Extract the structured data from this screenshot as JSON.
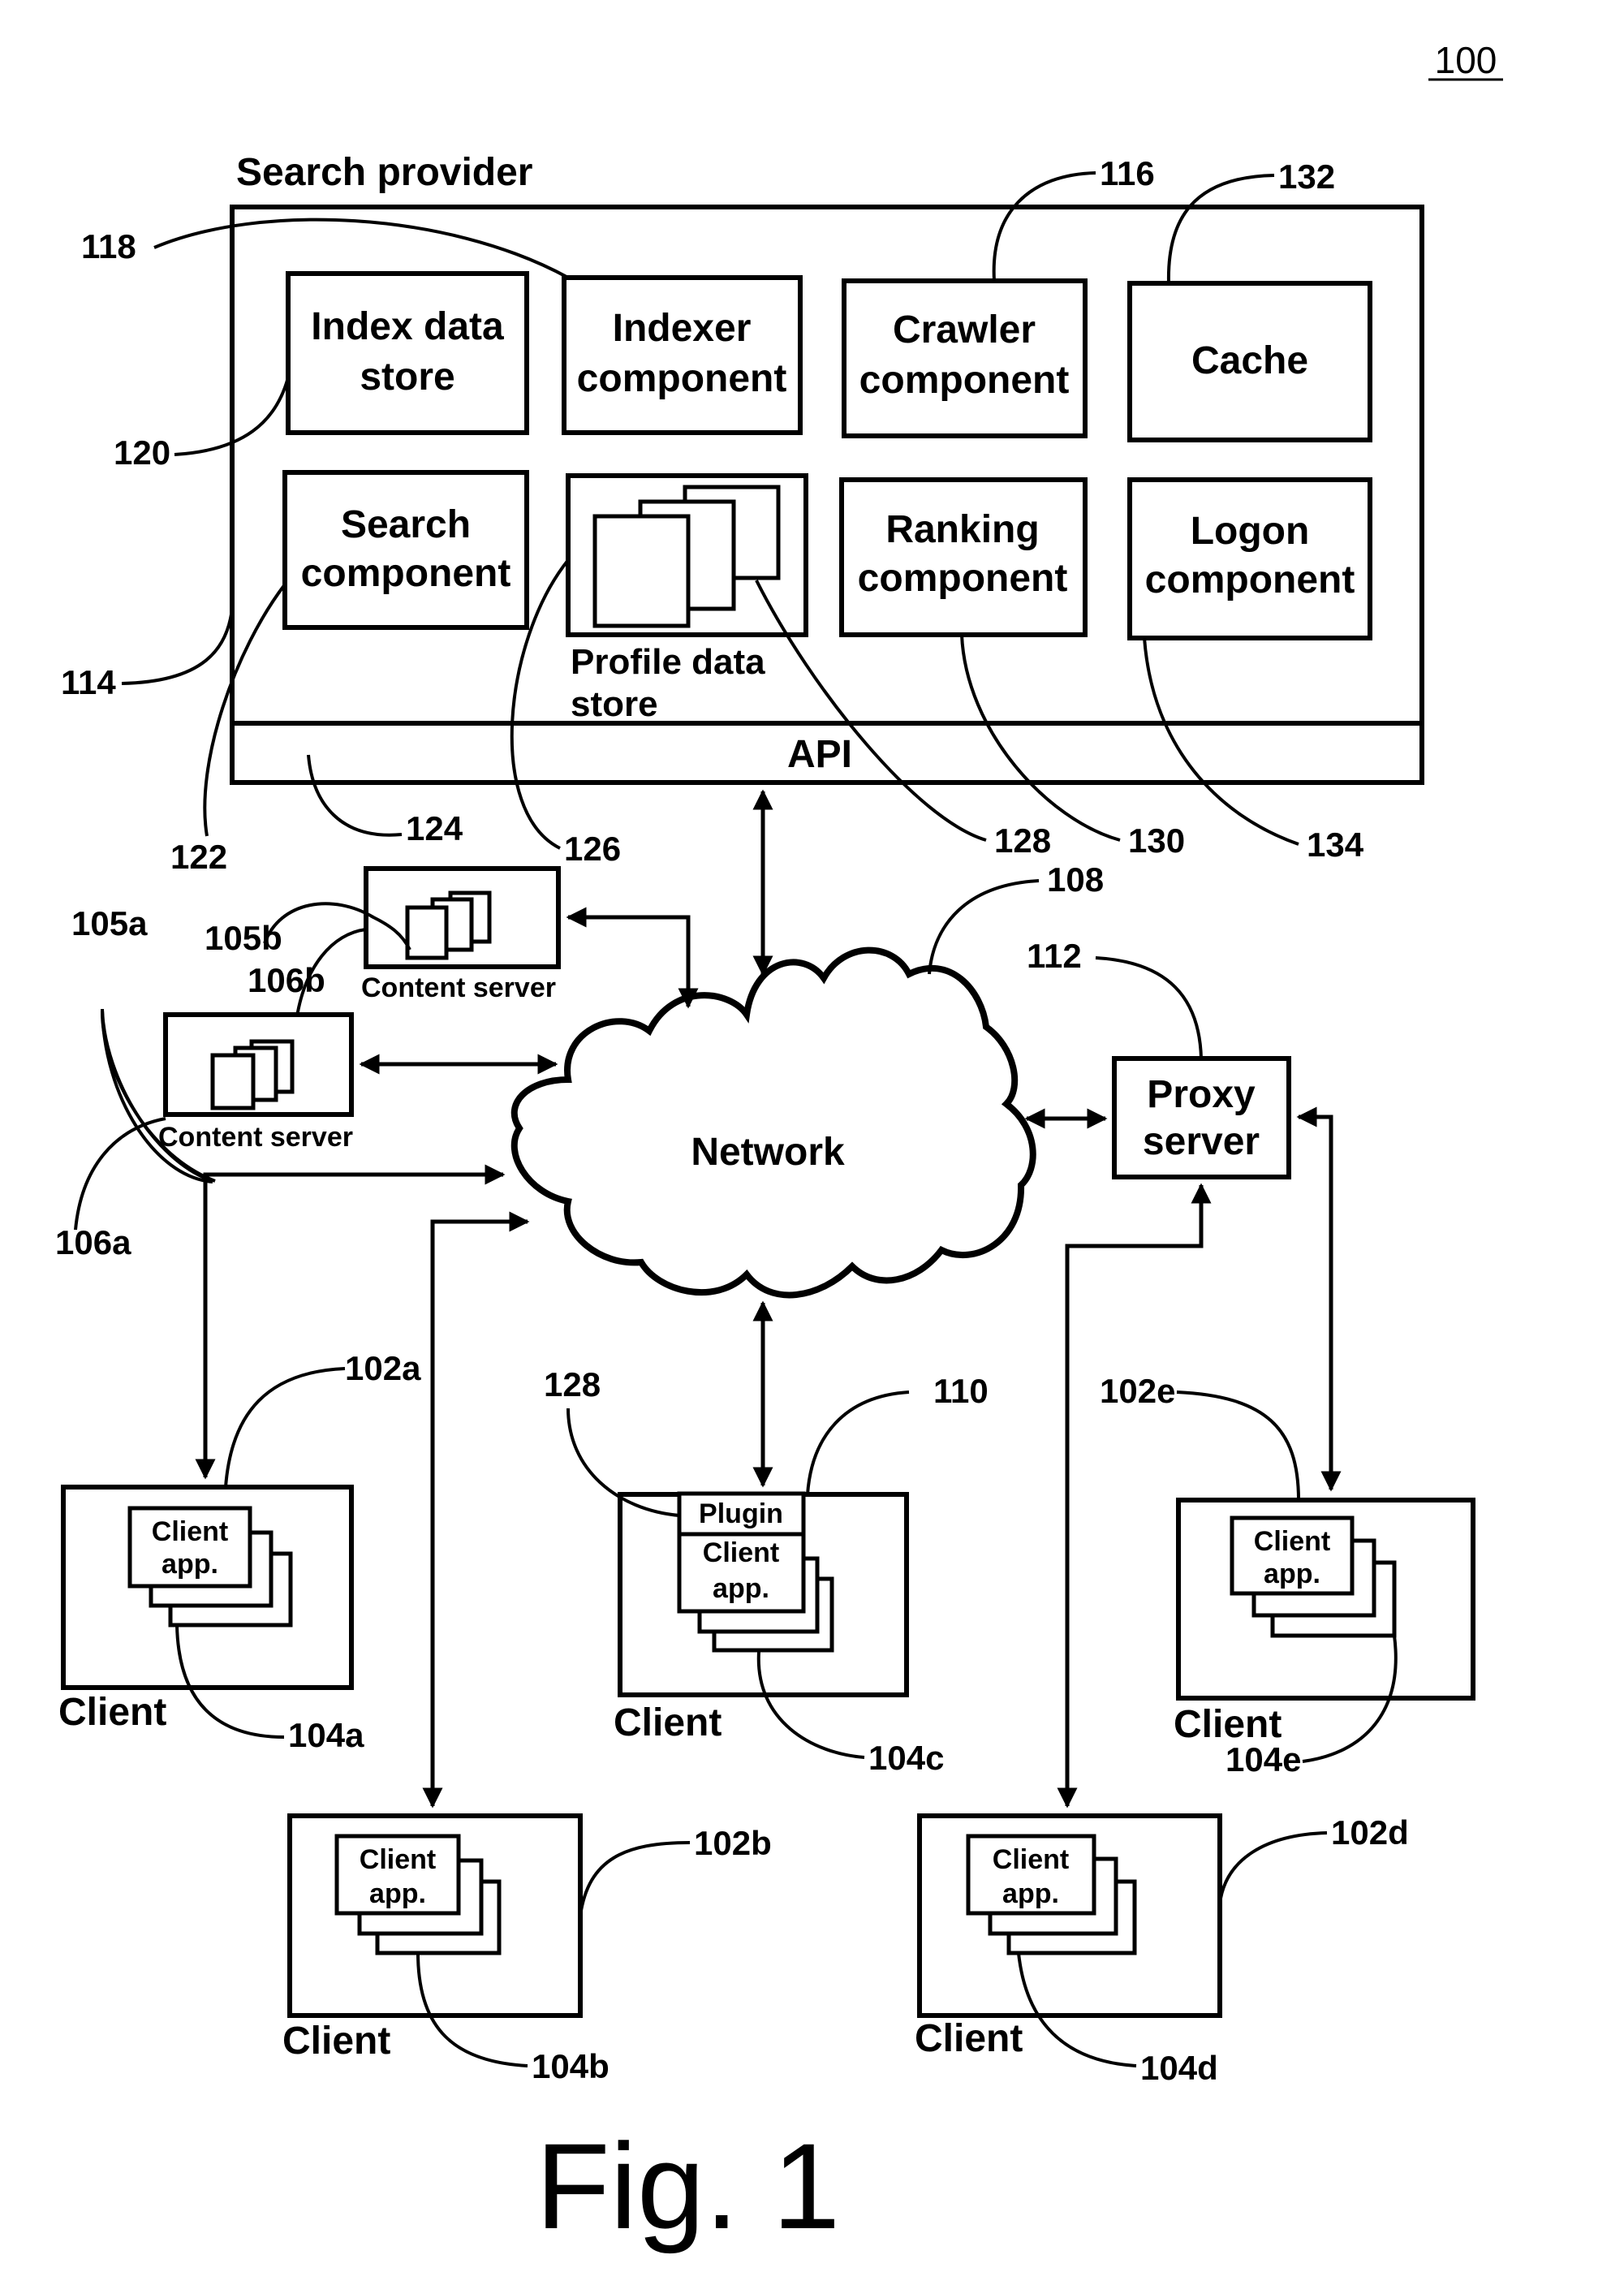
{
  "figure": {
    "number_label": "100",
    "caption": "Fig. 1"
  },
  "search_provider": {
    "title": "Search provider",
    "ref": "114",
    "components": [
      {
        "id": "index-data-store",
        "lines": [
          "Index data",
          "store"
        ],
        "ref": "120"
      },
      {
        "id": "indexer-component",
        "lines": [
          "Indexer",
          "component"
        ],
        "ref": "118"
      },
      {
        "id": "crawler-component",
        "lines": [
          "Crawler",
          "component"
        ],
        "ref": "116"
      },
      {
        "id": "cache",
        "lines": [
          "Cache"
        ],
        "ref": "132"
      },
      {
        "id": "search-component",
        "lines": [
          "Search",
          "component"
        ],
        "ref": "122"
      },
      {
        "id": "profile-data-store",
        "lines": [
          "Profile data",
          "store"
        ],
        "ref": "126",
        "sub_ref": "128"
      },
      {
        "id": "ranking-component",
        "lines": [
          "Ranking",
          "component"
        ],
        "ref": "130"
      },
      {
        "id": "logon-component",
        "lines": [
          "Logon",
          "component"
        ],
        "ref": "134"
      }
    ],
    "api": {
      "label": "API",
      "ref": "124"
    }
  },
  "network": {
    "label": "Network",
    "ref": "108"
  },
  "proxy_server": {
    "lines": [
      "Proxy",
      "server"
    ],
    "ref": "112"
  },
  "content_servers": [
    {
      "label": "Content server",
      "ref": "106a",
      "content_ref": "105a"
    },
    {
      "label": "Content server",
      "ref": "106b",
      "content_ref": "105b"
    }
  ],
  "clients": [
    {
      "label": "Client",
      "ref": "102a",
      "app_ref": "104a",
      "app_lines": [
        "Client",
        "app."
      ]
    },
    {
      "label": "Client",
      "ref": "102b",
      "app_ref": "104b",
      "app_lines": [
        "Client",
        "app."
      ]
    },
    {
      "label": "Client",
      "ref": "110",
      "app_ref": "104c",
      "app_lines": [
        "Client",
        "app."
      ],
      "plugin": "Plugin",
      "plugin_ref": "128"
    },
    {
      "label": "Client",
      "ref": "102d",
      "app_ref": "104d",
      "app_lines": [
        "Client",
        "app."
      ]
    },
    {
      "label": "Client",
      "ref": "102e",
      "app_ref": "104e",
      "app_lines": [
        "Client",
        "app."
      ]
    }
  ]
}
